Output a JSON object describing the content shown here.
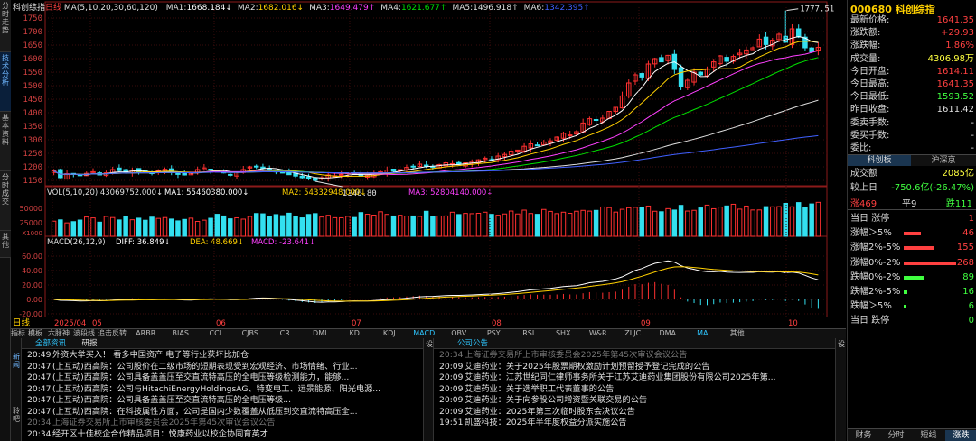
{
  "side_tabs": [
    "分时走势",
    "技术分析",
    "基本资料",
    "分时成交",
    "其他"
  ],
  "header": {
    "name": "科创综指",
    "period_label": "日线",
    "ma_title": "MA(5,10,20,30,60,120)",
    "ma": [
      {
        "label": "MA1:",
        "val": "1668.184↓",
        "color": "#ffffff"
      },
      {
        "label": "MA2:",
        "val": "1682.016↓",
        "color": "#ffd000"
      },
      {
        "label": "MA3:",
        "val": "1649.479↑",
        "color": "#ff40ff"
      },
      {
        "label": "MA4:",
        "val": "1621.677↑",
        "color": "#00e000"
      },
      {
        "label": "MA5:",
        "val": "1496.918↑",
        "color": "#e0e0e0"
      },
      {
        "label": "MA6:",
        "val": "1342.395↑",
        "color": "#4060ff"
      }
    ]
  },
  "price_axis": [
    "1750",
    "1700",
    "1650",
    "1600",
    "1550",
    "1500",
    "1450",
    "1400",
    "1350",
    "1300",
    "1250",
    "1200",
    "1150"
  ],
  "annotations": {
    "high": "1777.51",
    "low": "1146.80"
  },
  "vol": {
    "title": "VOL(5,10,20)",
    "v": "43069752.000↓",
    "ma1": "MA1: 55460380.000↓",
    "ma2": "MA2: 54332948.000↓",
    "ma3": "MA3: 52804140.000↓",
    "axis_top": "50000",
    "axis_mid": "25000",
    "unit": "X1000"
  },
  "macd": {
    "title": "MACD(26,12,9)",
    "diff": "DIFF: 36.849↓",
    "dea": "DEA: 48.669↓",
    "macd": "MACD: -23.641↓",
    "axis": [
      "60.00",
      "40.00",
      "20.00",
      "0.00",
      "-20.00"
    ]
  },
  "date_axis": {
    "period": "日线",
    "labels": [
      "2025/04",
      "05",
      "06",
      "07",
      "08",
      "09",
      "10"
    ]
  },
  "indicator_tabs": [
    "指标",
    "模板",
    "六脉神剑",
    "波段线",
    "追击反转",
    "ARBR",
    "BIAS",
    "CCI",
    "CJBS",
    "CR",
    "DMI",
    "KD",
    "KDJ",
    "MACD",
    "OBV",
    "PSY",
    "RSI",
    "SHX",
    "W&R",
    "ZLJC",
    "DMA",
    "MA",
    "其他"
  ],
  "chart_data": {
    "type": "candlestick",
    "title": "科创综指",
    "period": "日线",
    "x_labels": [
      "2025/04",
      "05",
      "06",
      "07",
      "08",
      "09",
      "10"
    ],
    "ylim": [
      1130,
      1790
    ],
    "y_ticks": [
      1750,
      1700,
      1650,
      1600,
      1550,
      1500,
      1450,
      1400,
      1350,
      1300,
      1250,
      1200,
      1150
    ],
    "closes": [
      1185,
      1160,
      1175,
      1172,
      1168,
      1176,
      1182,
      1170,
      1178,
      1190,
      1186,
      1181,
      1188,
      1183,
      1179,
      1176,
      1185,
      1191,
      1180,
      1172,
      1170,
      1176,
      1190,
      1196,
      1188,
      1181,
      1178,
      1170,
      1180,
      1190,
      1200,
      1202,
      1195,
      1188,
      1182,
      1177,
      1171,
      1166,
      1160,
      1157,
      1150,
      1160,
      1170,
      1167,
      1172,
      1178,
      1173,
      1166,
      1168,
      1177,
      1182,
      1188,
      1184,
      1190,
      1198,
      1202,
      1210,
      1204,
      1200,
      1208,
      1215,
      1212,
      1209,
      1215,
      1220,
      1226,
      1232,
      1228,
      1240,
      1246,
      1258,
      1262,
      1276,
      1285,
      1280,
      1292,
      1296,
      1310,
      1324,
      1318,
      1330,
      1362,
      1378,
      1372,
      1380,
      1405,
      1420,
      1462,
      1510,
      1540,
      1532,
      1580,
      1600,
      1588,
      1612,
      1560,
      1498,
      1520,
      1550,
      1540,
      1562,
      1588,
      1610,
      1590,
      1608,
      1620,
      1632,
      1640,
      1672,
      1652,
      1668,
      1690,
      1660,
      1710,
      1680,
      1640,
      1625,
      1641.35
    ],
    "high": 1777.51,
    "low": 1146.8
  },
  "right_panel": {
    "code": "000680",
    "name": "科创综指",
    "rows": [
      {
        "label": "最新价格:",
        "value": "1641.35",
        "color": "#ff4040"
      },
      {
        "label": "涨跌额:",
        "value": "+29.93",
        "color": "#ff4040"
      },
      {
        "label": "涨跌幅:",
        "value": "1.86%",
        "color": "#ff4040"
      },
      {
        "label": "成交量:",
        "value": "4306.98万",
        "color": "#ffff40"
      },
      {
        "label": "今日开盘:",
        "value": "1614.11",
        "color": "#ff4040"
      },
      {
        "label": "今日最高:",
        "value": "1641.35",
        "color": "#ff4040"
      },
      {
        "label": "今日最低:",
        "value": "1593.52",
        "color": "#40ff40"
      },
      {
        "label": "昨日收盘:",
        "value": "1611.42",
        "color": "#e0e0e0"
      },
      {
        "label": "委卖手数:",
        "value": "-",
        "color": "#e0e0e0"
      },
      {
        "label": "委买手数:",
        "value": "-",
        "color": "#e0e0e0"
      },
      {
        "label": "委比:",
        "value": "-",
        "color": "#e0e0e0"
      }
    ],
    "tabs": [
      "科创板",
      "沪深京"
    ],
    "turnover_label": "成交额",
    "turnover": "2085亿",
    "vs_label": "较上日",
    "vs": "-750.6亿(-26.47%)",
    "up": "涨469",
    "flat": "平9",
    "down": "跌111",
    "dist": [
      {
        "label": "当日 涨停",
        "value": "1",
        "color": "#ff4040",
        "bar": 0
      },
      {
        "label": "涨幅＞5%",
        "value": "46",
        "color": "#ff4040",
        "bar": 0.33
      },
      {
        "label": "涨幅2%-5%",
        "value": "155",
        "color": "#ff4040",
        "bar": 0.58
      },
      {
        "label": "涨幅0%-2%",
        "value": "268",
        "color": "#ff4040",
        "bar": 1.0
      },
      {
        "label": "跌幅0%-2%",
        "value": "89",
        "color": "#40ff40",
        "bar": 0.38
      },
      {
        "label": "跌幅2%-5%",
        "value": "16",
        "color": "#40ff40",
        "bar": 0.07
      },
      {
        "label": "跌幅＞5%",
        "value": "6",
        "color": "#40ff40",
        "bar": 0.02
      },
      {
        "label": "当日 跌停",
        "value": "0",
        "color": "#40ff40",
        "bar": 0
      }
    ],
    "bottom_tabs": [
      "财务",
      "分时",
      "短线",
      "涨跌"
    ]
  },
  "news_left": {
    "tabs": [
      "全部资讯",
      "研报"
    ],
    "side": [
      "新闻",
      "聆吧"
    ],
    "settings": "设",
    "items": [
      {
        "time": "20:49",
        "text": "外资大举买入！ 看多中国资产 电子等行业获坏比加仓",
        "dim": false
      },
      {
        "time": "20:47",
        "text": "(上互动)西高院：公司股价在二级市场的短期表现受到宏观经济、市场情绪、行业...",
        "dim": false
      },
      {
        "time": "20:47",
        "text": "(上互动)西高院：公司具备盖盖压至交直流特高压的全电压等级检测能力，能够...",
        "dim": false
      },
      {
        "time": "20:47",
        "text": "(上互动)西高院：公司与HitachiEnergyHoldingsAG、特变电工、远景能源、阳光电源...",
        "dim": false
      },
      {
        "time": "20:47",
        "text": "(上互动)西高院：公司具备盖盖压至交直流特高压的全电压等级...",
        "dim": false
      },
      {
        "time": "20:47",
        "text": "(上互动)西高院：在科技属性方面，公司是国内少数覆盖从低压到交直流特高压全...",
        "dim": false
      },
      {
        "time": "20:34",
        "text": "上海证券交易所上市审核委员会2025年第45次审议会议公告",
        "dim": true
      },
      {
        "time": "20:34",
        "text": "经开区十佳校企合作精品项目：悦康药业以校企协同育英才",
        "dim": false
      }
    ]
  },
  "news_right": {
    "tab": "公司公告",
    "settings": "设",
    "items": [
      {
        "time": "20:34",
        "text": "上海证券交易所上市审核委员会2025年第45次审议会议公告",
        "dim": true
      },
      {
        "time": "20:09",
        "text": "艾迪药业：关于2025年股票期权激励计划预留授予登记完成的公告",
        "dim": false
      },
      {
        "time": "20:09",
        "text": "艾迪药业：江苏世纪同仁律师事务所关于江苏艾迪药业集团股份有限公司2025年第...",
        "dim": false
      },
      {
        "time": "20:09",
        "text": "艾迪药业：关于选举职工代表董事的公告",
        "dim": false
      },
      {
        "time": "20:09",
        "text": "艾迪药业：关于向参股公司增资暨关联交易的公告",
        "dim": false
      },
      {
        "time": "20:09",
        "text": "艾迪药业：2025年第三次临时股东会决议公告",
        "dim": false
      },
      {
        "time": "19:51",
        "text": "凯盛科技：2025年半年度权益分派实施公告",
        "dim": false
      }
    ]
  }
}
